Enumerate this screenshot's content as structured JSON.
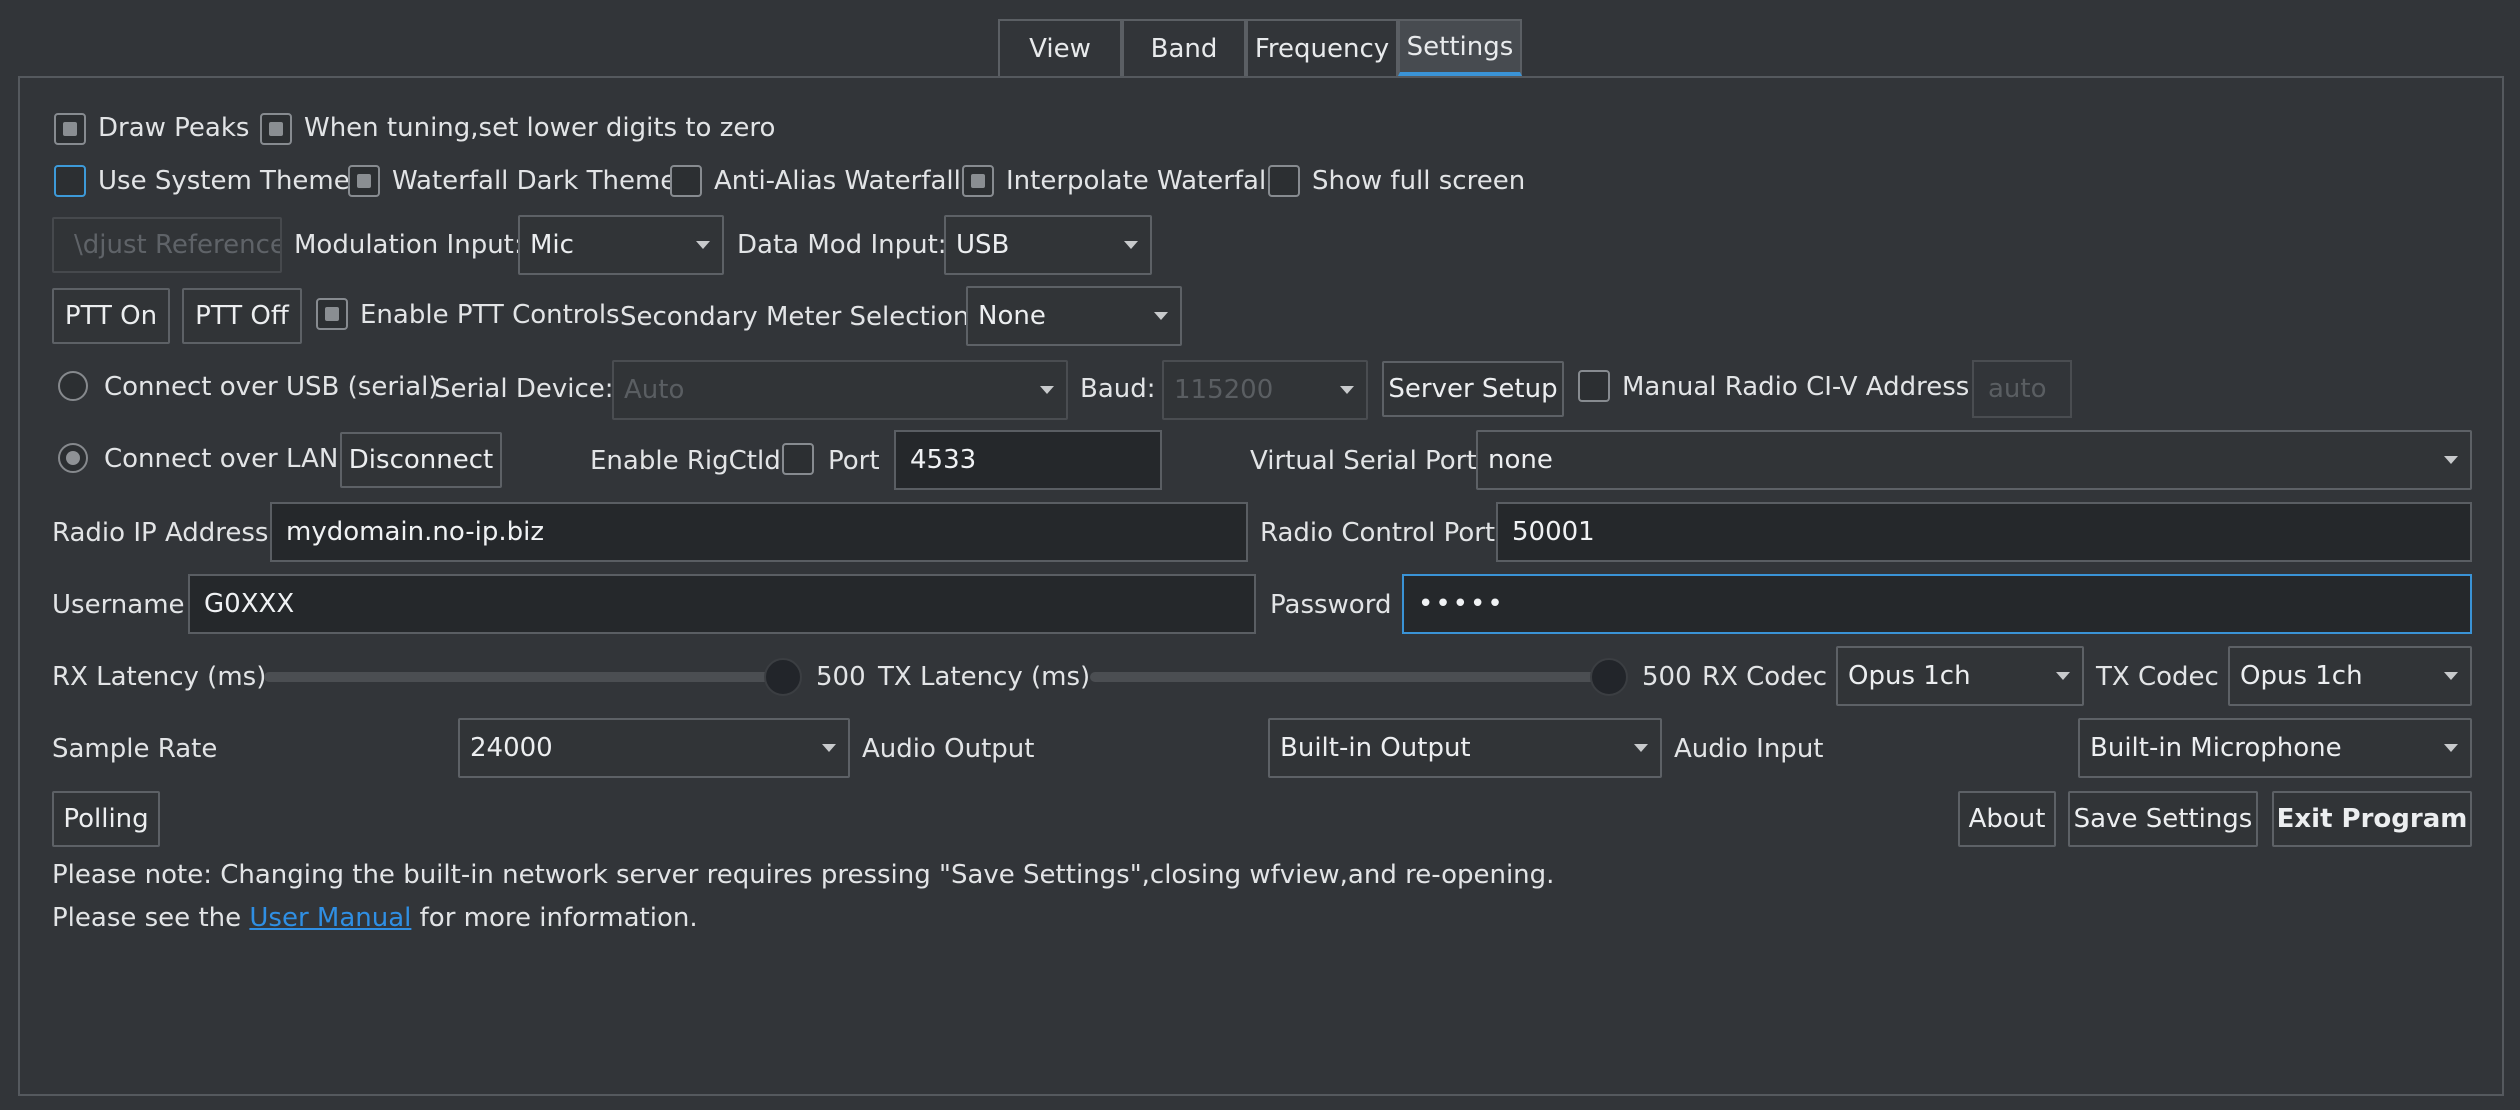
{
  "tabs": [
    "View",
    "Band",
    "Frequency",
    "Settings"
  ],
  "active_tab": "Settings",
  "row1": {
    "draw_peaks": "Draw Peaks",
    "tuning_zero": "When tuning,set lower digits to zero"
  },
  "row2": {
    "use_system_theme": "Use System Theme",
    "waterfall_dark": "Waterfall Dark Theme",
    "anti_alias": "Anti-Alias Waterfall",
    "interpolate": "Interpolate Waterfall",
    "full_screen": "Show full screen"
  },
  "row3": {
    "adjust_reference": "\\djust Reference",
    "modulation_input_label": "Modulation Input:",
    "modulation_input_value": "Mic",
    "data_mod_label": "Data Mod Input:",
    "data_mod_value": "USB"
  },
  "row4": {
    "ptt_on": "PTT On",
    "ptt_off": "PTT Off",
    "enable_ptt": "Enable PTT Controls",
    "secondary_meter_label": "Secondary Meter Selection:",
    "secondary_meter_value": "None"
  },
  "row5": {
    "connect_usb": "Connect over USB (serial)",
    "serial_device_label": "Serial Device:",
    "serial_device_value": "Auto",
    "baud_label": "Baud:",
    "baud_value": "115200",
    "server_setup": "Server Setup",
    "manual_civ": "Manual Radio CI-V Address:",
    "civ_value": "auto"
  },
  "row6": {
    "connect_lan": "Connect over LAN",
    "disconnect": "Disconnect",
    "enable_rigctld": "Enable RigCtld",
    "port_label": "Port",
    "port_value": "4533",
    "virtual_serial_label": "Virtual Serial Port",
    "virtual_serial_value": "none"
  },
  "row7": {
    "radio_ip_label": "Radio IP Address",
    "radio_ip_value": "mydomain.no-ip.biz",
    "control_port_label": "Radio Control Port",
    "control_port_value": "50001"
  },
  "row8": {
    "username_label": "Username",
    "username_value": "G0XXX",
    "password_label": "Password",
    "password_value": "•••••"
  },
  "row9": {
    "rx_latency_label": "RX Latency (ms)",
    "rx_latency_value": "500",
    "tx_latency_label": "TX Latency (ms)",
    "tx_latency_value": "500",
    "rx_codec_label": "RX Codec",
    "rx_codec_value": "Opus 1ch",
    "tx_codec_label": "TX Codec",
    "tx_codec_value": "Opus 1ch"
  },
  "row10": {
    "sample_rate_label": "Sample Rate",
    "sample_rate_value": "24000",
    "audio_output_label": "Audio Output",
    "audio_output_value": "Built-in Output",
    "audio_input_label": "Audio Input",
    "audio_input_value": "Built-in Microphone"
  },
  "row11": {
    "polling": "Polling",
    "about": "About",
    "save_settings": "Save Settings",
    "exit_program": "Exit Program"
  },
  "notes": {
    "line1": "Please note: Changing  the built-in network server requires pressing \"Save Settings\",closing wfview,and re-opening.",
    "line2_prefix": "Please see the ",
    "line2_link": "User Manual",
    "line2_suffix": " for more information."
  },
  "colors": {
    "background": "#323539",
    "accent": "#3a93d6",
    "link": "#2f8fe4"
  }
}
